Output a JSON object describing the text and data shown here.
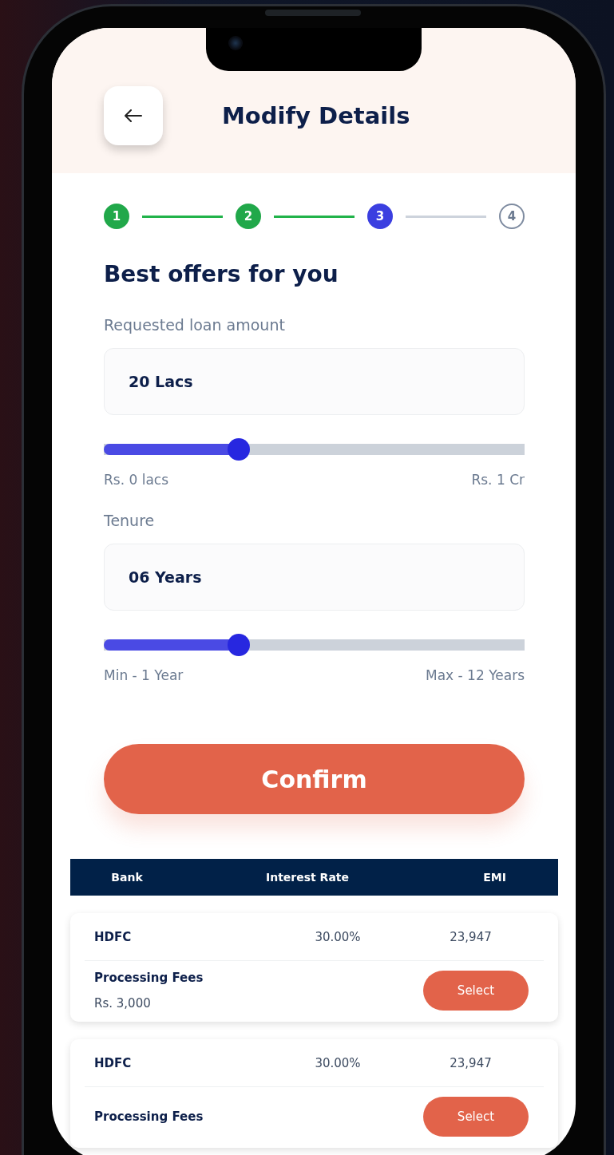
{
  "header": {
    "title": "Modify Details"
  },
  "steps": [
    {
      "label": "1",
      "done": true,
      "current": false
    },
    {
      "label": "2",
      "done": true,
      "current": false
    },
    {
      "label": "3",
      "done": false,
      "current": true
    },
    {
      "label": "4",
      "done": false,
      "current": false
    }
  ],
  "heading": "Best offers for you",
  "loan": {
    "label": "Requested loan amount",
    "value": "20 Lacs",
    "level": 0.32,
    "min_label": "Rs. 0 lacs",
    "max_label": "Rs. 1 Cr"
  },
  "tenure": {
    "label": "Tenure",
    "value": "06 Years",
    "level": 0.32,
    "min_label": "Min - 1 Year",
    "max_label": "Max - 12 Years"
  },
  "confirm_button": "Confirm",
  "table": {
    "columns": [
      "Bank",
      "Interest Rate",
      "EMI"
    ],
    "rows": [
      {
        "bank": "HDFC",
        "interest_rate": "30.00%",
        "emi": "23,947",
        "fee_label": "Processing Fees",
        "fee_value": "Rs. 3,000",
        "button": "Select"
      },
      {
        "bank": "HDFC",
        "interest_rate": "30.00%",
        "emi": "23,947",
        "fee_label": "Processing Fees",
        "button": "Select"
      }
    ]
  }
}
